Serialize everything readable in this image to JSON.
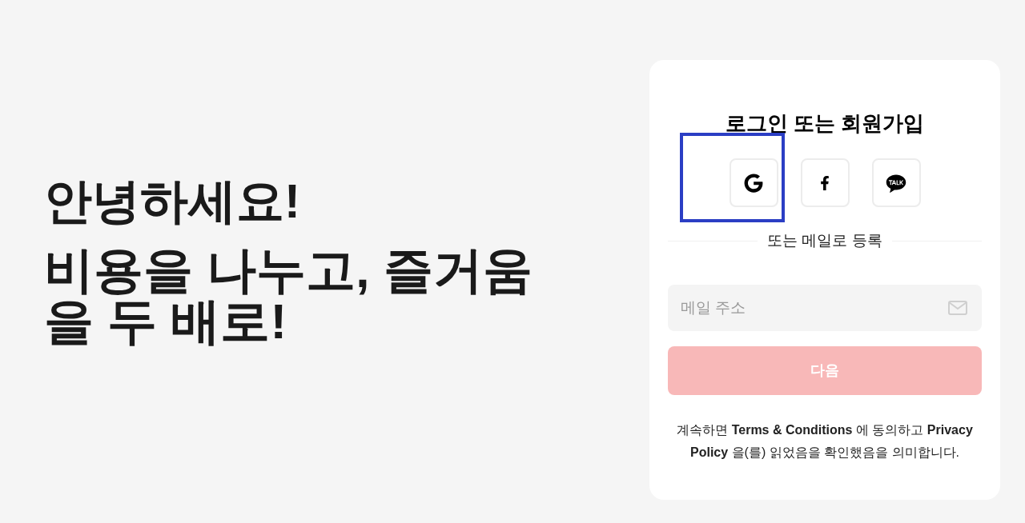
{
  "hero": {
    "greeting": "안녕하세요!",
    "tagline": "비용을 나누고, 즐거움을 두 배로!"
  },
  "login_card": {
    "title": "로그인 또는 회원가입",
    "social_buttons": [
      {
        "kind": "google"
      },
      {
        "kind": "facebook"
      },
      {
        "kind": "kakao"
      }
    ],
    "annotation_frame": {
      "shown": true
    },
    "divider_label": "또는 메일로 등록",
    "email_field": {
      "placeholder": "메일 주소"
    },
    "next_button": {
      "label": "다음",
      "disabled": true
    },
    "terms": "계속하면 **Terms & Conditions** 에 동의하고 **Privacy Policy** 을(를) 읽었음을 확인했음을 의미합니다."
  }
}
